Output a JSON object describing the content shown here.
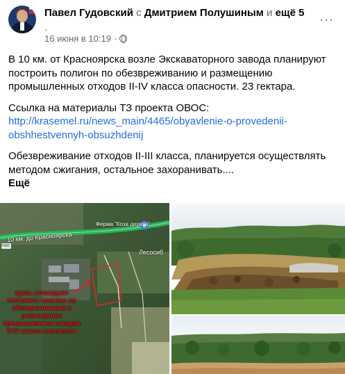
{
  "post": {
    "author": "Павел Гудовский",
    "with_word": "с",
    "tagged": "Дмитрием Полушиным",
    "and_word": "и",
    "more_people": "ещё 5",
    "dot": ".",
    "date": "16 июня в 10:19",
    "separator": "·",
    "more_icon": "···"
  },
  "body": {
    "p1": "В 10 км. от Красноярска возле Экскаваторного завода планируют построить полигон по обезвреживанию и размещению промышленных отходов II-IV класса опасности. 23 гектара.",
    "p2_label": "Ссылка на материалы ТЗ проекта ОВОС:",
    "p2_link": "http://krasemel.ru/news_main/4465/obyavlenie-o-provedenii-obshhestvennyh-obsuzhdenij",
    "p3": "Обезвреживание отходов II-III класса, планируется осуществлять методом сжигания, остальное захоранивать....",
    "see_more": "Ещё"
  },
  "map": {
    "road_label": "10 км. до Красноярска",
    "farm_label": "Ферма \"Коза дереза\"",
    "forest_label": "Лесосиб",
    "road_sign": "Р409",
    "caption": "здесь планируют построить полигон по обезвреживанию и размещению промышленных отходов II-IV класса опасности"
  },
  "colors": {
    "link": "#216fdb",
    "secondary": "#65676b",
    "caption_red": "#e31b1b",
    "road_green": "#29b35a"
  }
}
